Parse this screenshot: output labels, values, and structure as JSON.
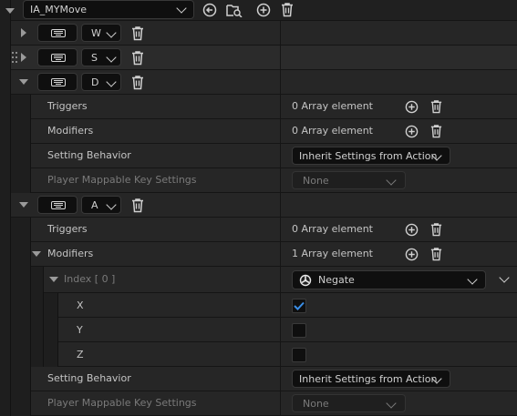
{
  "header": {
    "asset_name": "IA_MYMove",
    "icons": [
      "browse-to-asset-icon",
      "find-in-browser-icon",
      "add-mapping-icon",
      "delete-mapping-icon"
    ]
  },
  "mappings": [
    {
      "key": "W"
    },
    {
      "key": "S"
    },
    {
      "key": "D"
    },
    {
      "key": "A"
    }
  ],
  "mapping_d": {
    "triggers_label": "Triggers",
    "triggers_value": "0 Array element",
    "modifiers_label": "Modifiers",
    "modifiers_value": "0 Array element",
    "setting_behavior_label": "Setting Behavior",
    "setting_behavior_value": "Inherit Settings from Action",
    "pmk_label": "Player Mappable Key Settings",
    "pmk_value": "None"
  },
  "mapping_a": {
    "triggers_label": "Triggers",
    "triggers_value": "0 Array element",
    "modifiers_label": "Modifiers",
    "modifiers_value": "1 Array element",
    "index_label": "Index [ 0 ]",
    "modifier_type": "Negate",
    "x_label": "X",
    "x_checked": true,
    "y_label": "Y",
    "y_checked": false,
    "z_label": "Z",
    "z_checked": false,
    "setting_behavior_label": "Setting Behavior",
    "setting_behavior_value": "Inherit Settings from Action",
    "pmk_label": "Player Mappable Key Settings",
    "pmk_value": "None"
  },
  "colors": {
    "accent_check": "#3a8ee6",
    "panel_bg": "#262626",
    "field_bg": "#0f0f0f"
  }
}
